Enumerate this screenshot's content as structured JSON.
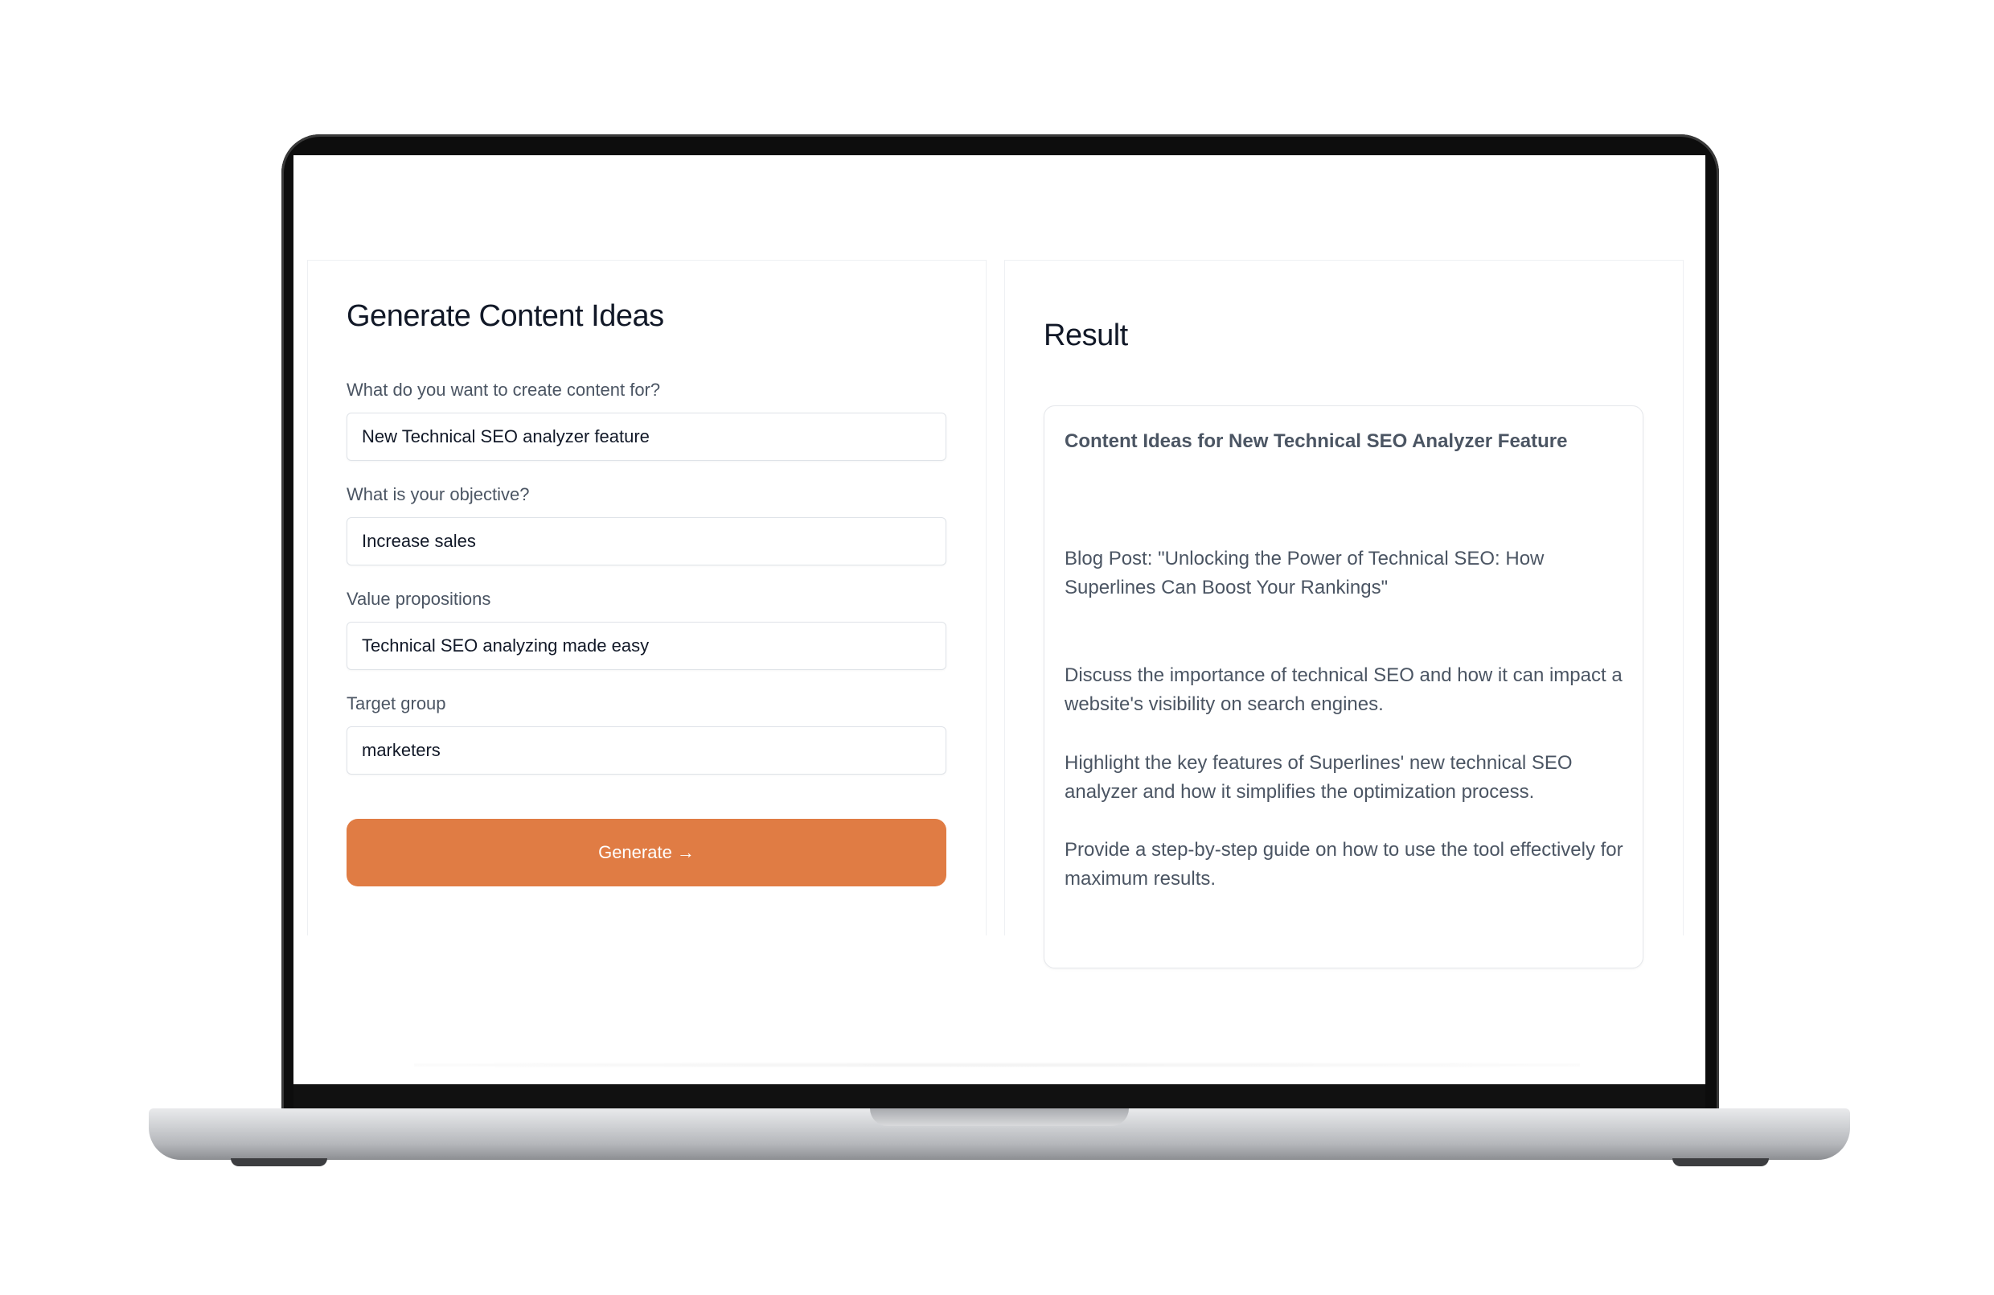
{
  "form": {
    "title": "Generate Content Ideas",
    "fields": [
      {
        "label": "What do you want to create content for?",
        "value": "New Technical SEO analyzer feature"
      },
      {
        "label": "What is your objective?",
        "value": "Increase sales"
      },
      {
        "label": "Value propositions",
        "value": "Technical SEO analyzing made easy"
      },
      {
        "label": "Target group",
        "value": "marketers"
      }
    ],
    "generate_label": "Generate →"
  },
  "result": {
    "title": "Result",
    "heading": "Content Ideas for New Technical SEO Analyzer Feature",
    "paragraphs": [
      "Blog Post: \"Unlocking the Power of Technical SEO: How Superlines Can Boost Your Rankings\"",
      "Discuss the importance of technical SEO and how it can impact a website's visibility on search engines.",
      "Highlight the key features of Superlines' new technical SEO analyzer and how it simplifies the optimization process.",
      "Provide a step-by-step guide on how to use the tool effectively for maximum results."
    ]
  },
  "colors": {
    "accent": "#e07c44",
    "text_primary": "#111827",
    "text_muted": "#4b5563"
  }
}
